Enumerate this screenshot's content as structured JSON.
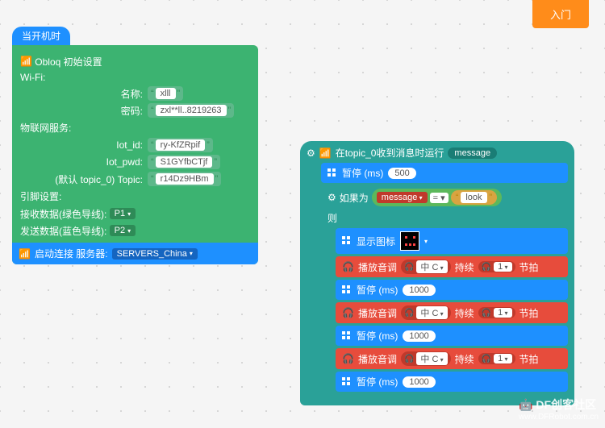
{
  "topBtn": "入门",
  "watermark": "DF创客社区",
  "watermark2": "www.DFRobot.com.cn",
  "hat1": {
    "title": "当开机时",
    "obloq": "Obloq 初始设置",
    "wifi": "Wi-Fi:",
    "nameLbl": "名称:",
    "nameVal": "xlll",
    "pwdLbl": "密码:",
    "pwdVal": "zxl**ll..8219263",
    "iot": "物联网服务:",
    "iotIdLbl": "Iot_id:",
    "iotIdVal": "ry-KfZRpif",
    "iotPwdLbl": "Iot_pwd:",
    "iotPwdVal": "S1GYfbCTjf",
    "topicLbl": "(默认 topic_0) Topic:",
    "topicVal": "r14Dz9HBm",
    "pin": "引脚设置:",
    "rxLbl": "接收数据(绿色导线):",
    "rxVal": "P1",
    "txLbl": "发送数据(蓝色导线):",
    "txVal": "P2",
    "startLbl": "启动连接  服务器:",
    "serverVal": "SERVERS_China"
  },
  "hat2": {
    "title": "在topic_0收到消息时运行",
    "msg": "message",
    "pause": "暂停 (ms)",
    "p500": "500",
    "ifLbl": "如果为",
    "msgVar": "message",
    "lookVal": "look",
    "then": "则",
    "showIcon": "显示图标",
    "playTone": "播放音调",
    "note": "中 C",
    "durLbl": "持续",
    "beat": "1",
    "beatLbl": "节拍",
    "p1000": "1000"
  }
}
